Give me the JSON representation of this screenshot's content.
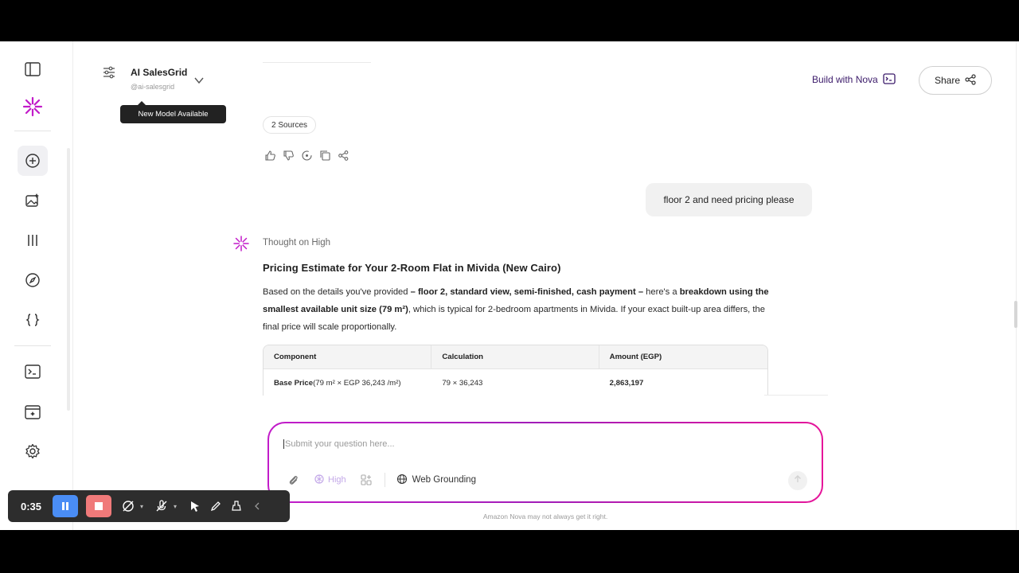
{
  "header": {
    "model_name": "AI SalesGrid",
    "model_handle": "@ai-salesgrid",
    "tooltip": "New Model Available",
    "build_label": "Build with Nova",
    "share_label": "Share"
  },
  "conversation": {
    "sources_label": "2 Sources",
    "user_message": "floor 2 and need pricing please",
    "thought_label": "Thought on High",
    "response_title": "Pricing Estimate for Your 2‑Room Flat in Mivida (New Cairo)",
    "response_body": {
      "p1": "Based on the details you've provided ",
      "b1": "– floor 2, standard view, semi‑finished, cash payment –",
      "p2": " here's a ",
      "b2": "breakdown using the smallest available unit size (79 m²)",
      "p3": ", which is typical for 2‑bedroom apartments in Mivida. If your exact built‑up area differs, the final price will scale proportionally."
    },
    "table": {
      "headers": [
        "Component",
        "Calculation",
        "Amount (EGP)"
      ],
      "rows": [
        {
          "component_bold": "Base Price",
          "component_rest": " (79 m² × EGP 36,243 /m²)",
          "calculation": "79 × 36,243",
          "amount": "2,863,197"
        }
      ]
    }
  },
  "composer": {
    "placeholder": "Submit your question here...",
    "high_label": "High",
    "web_label": "Web Grounding",
    "disclaimer": "Amazon Nova may not always get it right."
  },
  "recorder": {
    "time": "0:35"
  },
  "colors": {
    "accent": "#c21cc9",
    "brand_dark": "#3b1a6a",
    "pause_blue": "#4a8df5",
    "stop_red": "#f07a7a"
  }
}
